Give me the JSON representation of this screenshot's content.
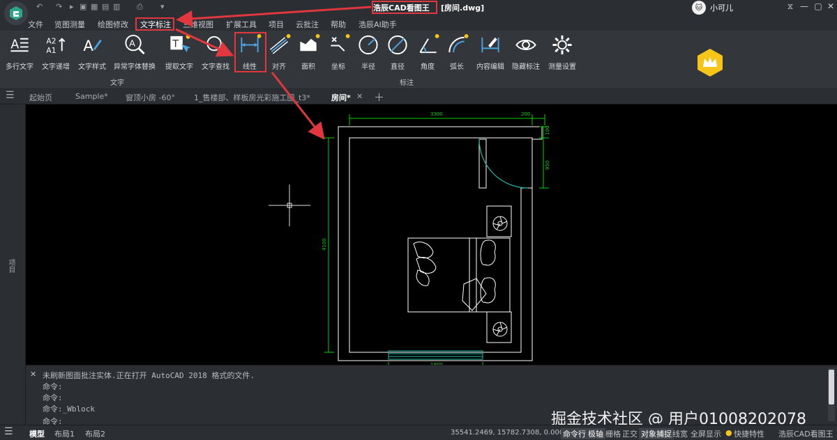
{
  "title": {
    "app_name": "浩辰CAD看图王",
    "file_name": "[房间.dwg]"
  },
  "user": {
    "name": "小可儿",
    "avatar_text": "🐱"
  },
  "window_controls": [
    "—",
    "▢",
    "⧉",
    "✕"
  ],
  "quick_access": [
    "↶",
    "↷",
    "▸",
    "▣",
    "▦",
    "▤",
    "▥",
    "⎙",
    "▾"
  ],
  "menu": [
    "文件",
    "览图测量",
    "绘图修改",
    "文字标注",
    "三维视图",
    "扩展工具",
    "项目",
    "云批注",
    "帮助",
    "浩辰AI助手"
  ],
  "ribbon": {
    "text_group": {
      "label": "文字",
      "tools": [
        "多行文字",
        "文字递增",
        "文字样式",
        "异常字体替换",
        "提取文字",
        "文字查找"
      ]
    },
    "dim_group": {
      "label": "标注",
      "tools": [
        "线性",
        "对齐",
        "面积",
        "坐标",
        "半径",
        "直径",
        "角度",
        "弧长",
        "内容编辑",
        "隐藏标注",
        "测量设置"
      ]
    }
  },
  "tabs": [
    "起始页",
    "Sample*",
    "窗顶小房 -60°",
    "1_售楼部、样板房光彩施工图_t3*",
    "房间*"
  ],
  "side_panel_label": "项目",
  "drawing": {
    "dims": {
      "top_width": "3300",
      "top_right": "200",
      "right_top": "100",
      "right_door": "950",
      "left_height": "4100",
      "bottom_window": "1800"
    }
  },
  "command_lines": [
    "未刷新图面批注实体.正在打开 AutoCAD 2018 格式的文件.",
    "命令:",
    "命令:",
    "命令:_Wblock",
    "命令:"
  ],
  "status": {
    "model_tab": "模型",
    "layout1": "布局1",
    "layout2": "布局2",
    "coords": "35541.2469, 15782.7308, 0.0000",
    "cmd_row": "命令行",
    "polar": "极轴",
    "grid": "栅格",
    "ortho": "正交",
    "osnap": "对象捕捉",
    "lineweight": "线宽",
    "fullscreen": "全屏显示",
    "quick_props": "快捷特性",
    "brand": "浩辰CAD看图王"
  },
  "watermark": "掘金技术社区 @ 用户01008202078",
  "colors": {
    "highlight": "#e0383e",
    "dim_green": "#00d200",
    "cyan": "#1fb8a8",
    "accent_gold": "#f5c518"
  }
}
